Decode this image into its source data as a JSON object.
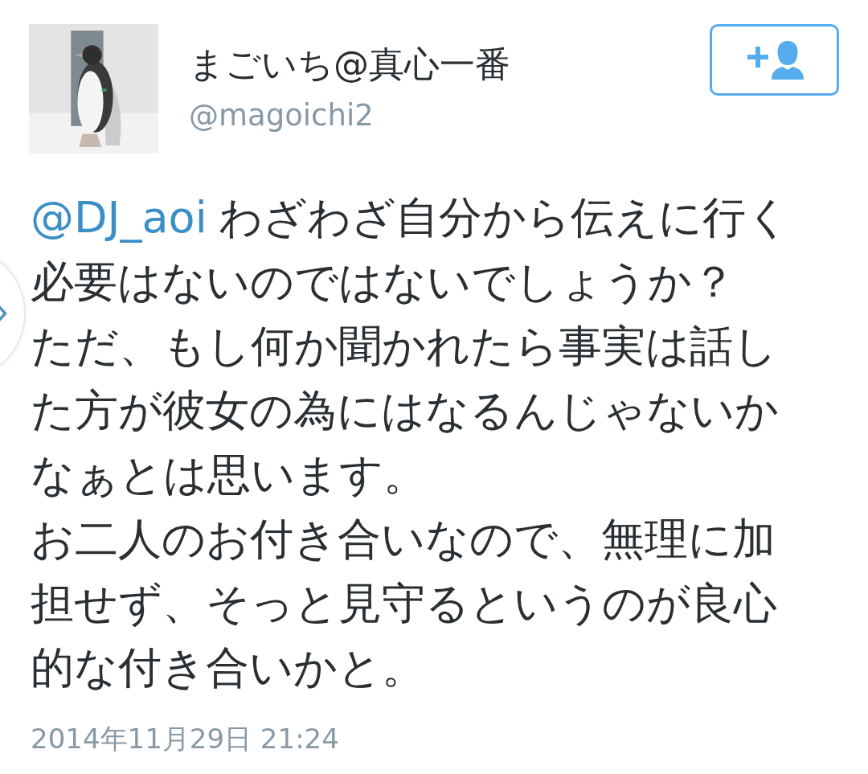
{
  "user": {
    "name": "まごいち@真心一番",
    "handle": "@magoichi2"
  },
  "follow_button": {
    "following": false
  },
  "tweet": {
    "mention": "@DJ_aoi",
    "paragraphs": [
      "わざわざ自分から伝えに行く必要はないのではないでしょうか？",
      "ただ、もし何か聞かれたら事実は話した方が彼女の為にはなるんじゃないかなぁとは思います。",
      "お二人のお付き合いなので、無理に加担せず、そっと見守るというのが良心的な付き合いかと。"
    ]
  },
  "timestamp": "2014年11月29日 21:24"
}
